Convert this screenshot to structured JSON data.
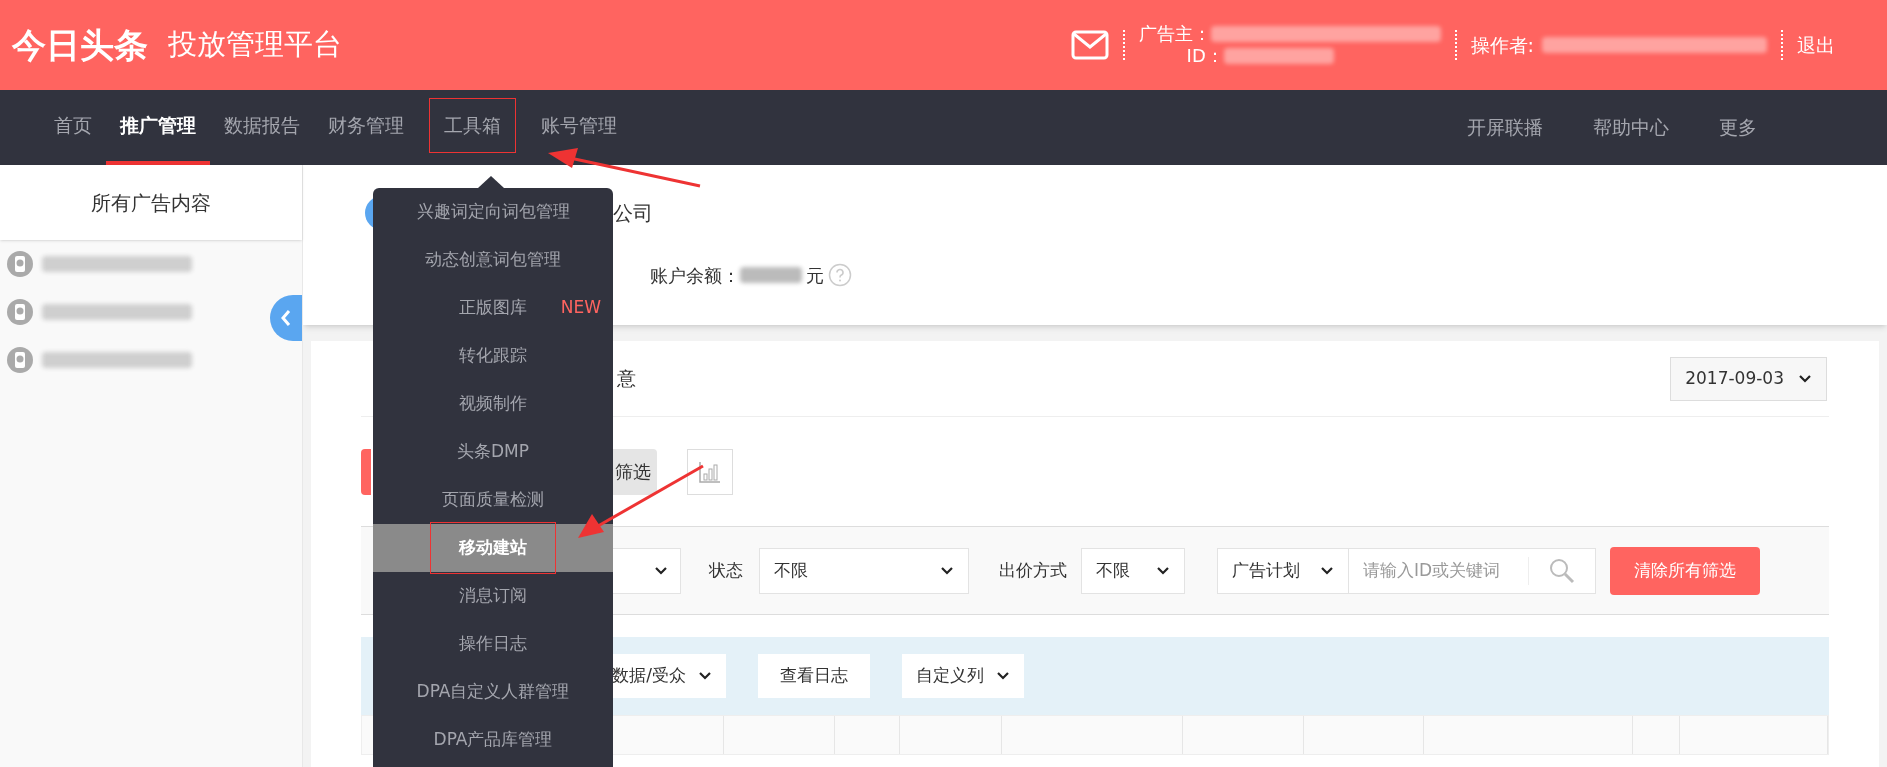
{
  "header": {
    "logo": "今日头条",
    "platform": "投放管理平台",
    "advertiser_label": "广告主：",
    "id_label": "ID：",
    "operator_label": "操作者:",
    "logout": "退出"
  },
  "nav": {
    "items": [
      {
        "label": "首页",
        "selected": false,
        "annotated": false
      },
      {
        "label": "推广管理",
        "selected": true,
        "annotated": false
      },
      {
        "label": "数据报告",
        "selected": false,
        "annotated": false
      },
      {
        "label": "财务管理",
        "selected": false,
        "annotated": false
      },
      {
        "label": "工具箱",
        "selected": false,
        "annotated": true
      },
      {
        "label": "账号管理",
        "selected": false,
        "annotated": false
      }
    ],
    "right_items": [
      "开屏联播",
      "帮助中心",
      "更多"
    ]
  },
  "sidebar": {
    "title": "所有广告内容",
    "items": [
      {
        "kind": "redacted"
      },
      {
        "kind": "redacted"
      },
      {
        "kind": "redacted"
      }
    ]
  },
  "tools_menu": {
    "items": [
      {
        "label": "兴趣词定向词包管理",
        "selected": false,
        "annotated": false
      },
      {
        "label": "动态创意词包管理",
        "selected": false,
        "annotated": false
      },
      {
        "label": "正版图库",
        "selected": false,
        "annotated": false,
        "badge": "NEW"
      },
      {
        "label": "转化跟踪",
        "selected": false,
        "annotated": false
      },
      {
        "label": "视频制作",
        "selected": false,
        "annotated": false
      },
      {
        "label": "头条DMP",
        "selected": false,
        "annotated": false
      },
      {
        "label": "页面质量检测",
        "selected": false,
        "annotated": false
      },
      {
        "label": "移动建站",
        "selected": true,
        "annotated": true
      },
      {
        "label": "消息订阅",
        "selected": false,
        "annotated": false
      },
      {
        "label": "操作日志",
        "selected": false,
        "annotated": false
      },
      {
        "label": "DPA自定义人群管理",
        "selected": false,
        "annotated": false
      },
      {
        "label": "DPA产品库管理",
        "selected": false,
        "annotated": false
      }
    ]
  },
  "account": {
    "company_suffix": "公司",
    "balance_label": "账户余额：",
    "balance_unit": "元"
  },
  "ads": {
    "title_suffix": "意",
    "date": "2017-09-03",
    "filter_button": "筛选",
    "filters": {
      "status_label": "状态",
      "status_value": "不限",
      "bid_label": "出价方式",
      "bid_value": "不限",
      "scope": "广告计划",
      "search_placeholder": "请输入ID或关键词",
      "clear_button": "清除所有筛选"
    },
    "toolbar": {
      "data_select": "数据/受众",
      "log_button": "查看日志",
      "columns_select": "自定义列"
    }
  }
}
